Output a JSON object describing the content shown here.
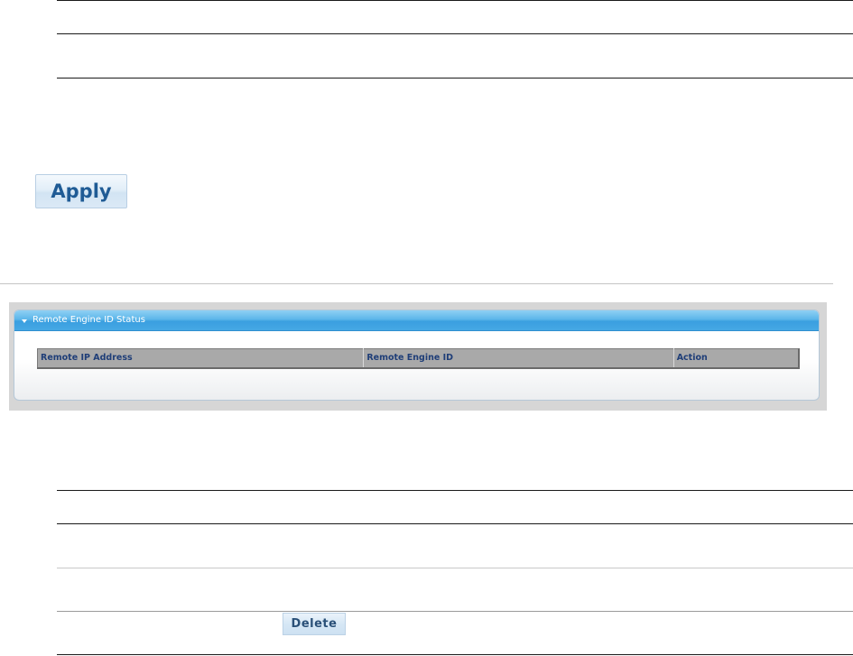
{
  "config_section": {
    "apply_label": "Apply"
  },
  "remote_engine_panel": {
    "title": "Remote Engine ID Status",
    "columns": [
      "Remote IP Address",
      "Remote Engine ID",
      "Action"
    ]
  },
  "entry_section": {
    "delete_label": "Delete"
  },
  "colors": {
    "panel_header": "#4aa8e4",
    "table_header_bg": "#a9a9a9",
    "table_header_text": "#1f3e78",
    "button_text": "#1f5b95"
  },
  "icons": {
    "panel_toggle": "triangle-down-icon"
  }
}
